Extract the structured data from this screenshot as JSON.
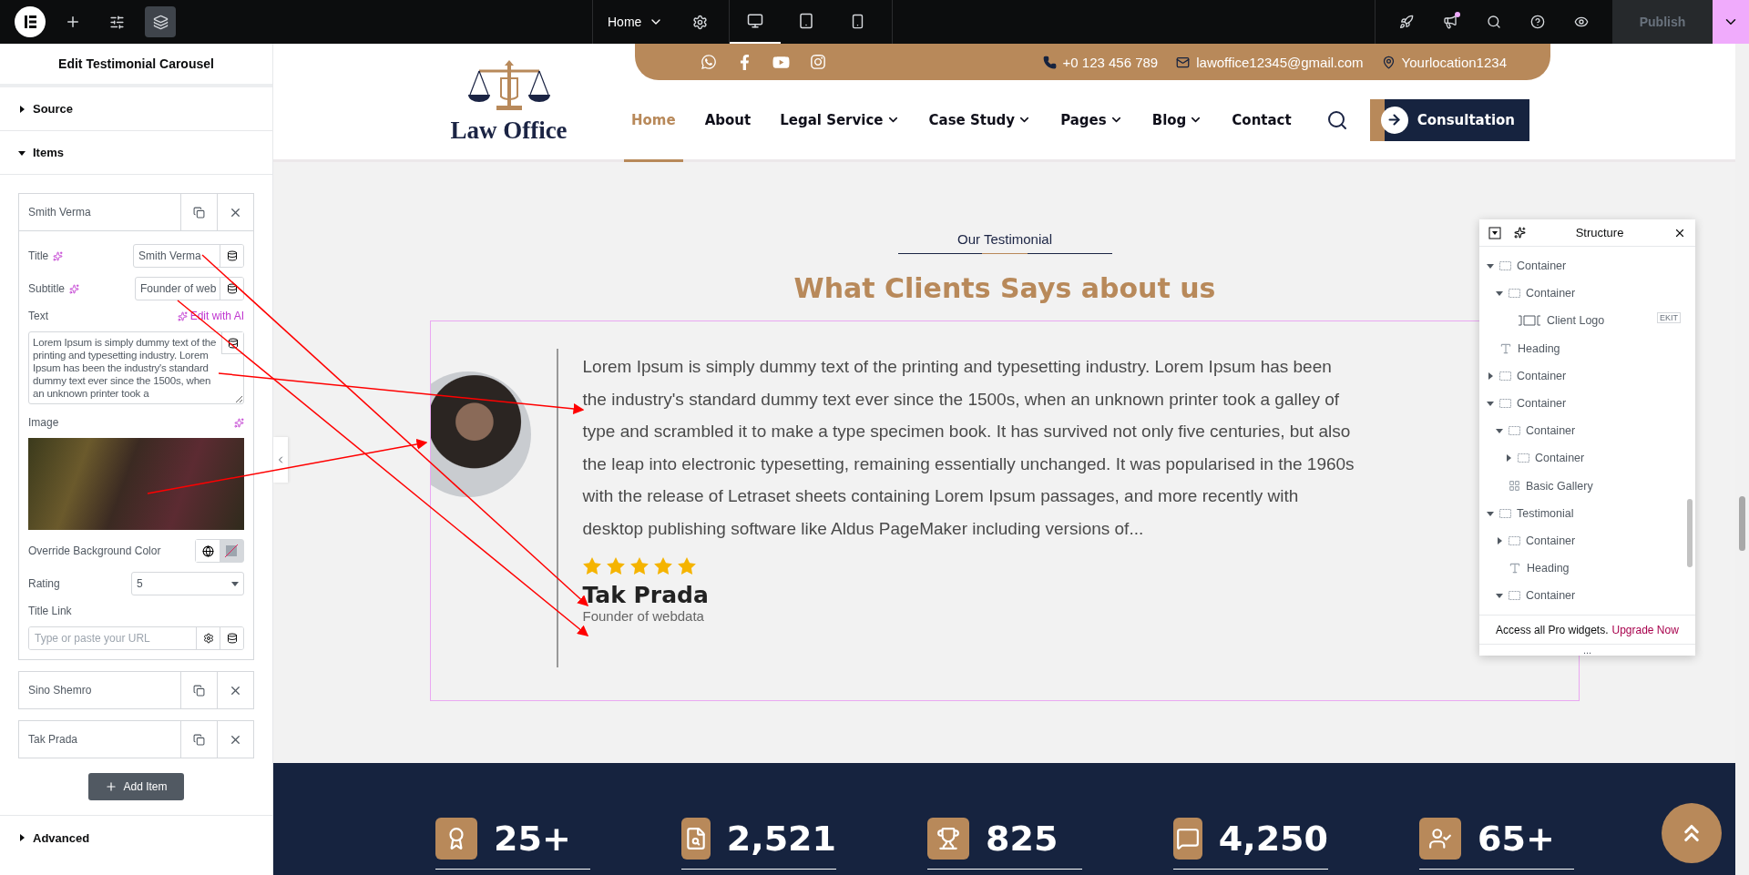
{
  "editor_bar": {
    "tools": [
      {
        "kind": "add",
        "selected": false
      },
      {
        "kind": "settings",
        "selected": false
      },
      {
        "kind": "structure",
        "selected": true
      }
    ],
    "page": "Home",
    "devices": [
      {
        "kind": "desktop",
        "selected": true
      },
      {
        "kind": "tablet",
        "selected": false
      },
      {
        "kind": "mobile",
        "selected": false
      }
    ],
    "actions": [
      {
        "kind": "launch",
        "notify": false
      },
      {
        "kind": "whatsnew",
        "notify": true
      },
      {
        "kind": "search",
        "notify": false
      },
      {
        "kind": "help",
        "notify": false
      },
      {
        "kind": "preview",
        "notify": false
      }
    ],
    "publish": "Publish"
  },
  "panel": {
    "title": "Edit Testimonial Carousel",
    "sections": [
      {
        "label": "Source",
        "expanded": false
      },
      {
        "label": "Items",
        "expanded": true
      }
    ],
    "items": [
      {
        "title": "Smith Verma",
        "expanded": true
      },
      {
        "title": "Sino Shemro",
        "expanded": false
      },
      {
        "title": "Tak Prada",
        "expanded": false
      }
    ],
    "form": {
      "title_label": "Title",
      "title_value": "Smith Verma",
      "subtitle_label": "Subtitle",
      "subtitle_value": "Founder of web",
      "text_label": "Text",
      "edit_ai": "Edit with AI",
      "text_value": "Lorem Ipsum is simply dummy text of the printing and typesetting industry. Lorem Ipsum has been the industry's standard dummy text ever since the 1500s, when an unknown printer took a",
      "image_label": "Image",
      "override_label": "Override Background Color",
      "rating_label": "Rating",
      "rating_value": "5",
      "link_label": "Title Link",
      "link_placeholder": "Type or paste your URL"
    },
    "add_item": "Add Item",
    "advanced": {
      "label": "Advanced",
      "expanded": false
    }
  },
  "site": {
    "contacts": {
      "phone": "+0 123 456 789",
      "email": "lawoffice12345@gmail.com",
      "location": "Yourlocation1234"
    },
    "logo": "Law Office",
    "nav": [
      {
        "label": "Home",
        "selected": true,
        "dropdown": false
      },
      {
        "label": "About",
        "selected": false,
        "dropdown": false
      },
      {
        "label": "Legal Service",
        "selected": false,
        "dropdown": true
      },
      {
        "label": "Case Study",
        "selected": false,
        "dropdown": true
      },
      {
        "label": "Pages",
        "selected": false,
        "dropdown": true
      },
      {
        "label": "Blog",
        "selected": false,
        "dropdown": true
      },
      {
        "label": "Contact",
        "selected": false,
        "dropdown": false
      }
    ],
    "cta": "Consultation",
    "testimonial": {
      "eyebrow": "Our Testimonial",
      "heading": "What Clients Says about us",
      "quote": "Lorem Ipsum is simply dummy text of the printing and typesetting industry. Lorem Ipsum has been the industry's standard dummy text ever since the 1500s, when an unknown printer took a galley of type and scrambled it to make a type specimen book. It has survived not only five centuries, but also the leap into electronic typesetting, remaining essentially unchanged. It was popularised in the 1960s with the release of Letraset sheets containing Lorem Ipsum passages, and more recently with desktop publishing software like Aldus PageMaker including versions of...",
      "stars": 5,
      "name": "Tak Prada",
      "role": "Founder of webdata"
    },
    "stats": [
      {
        "kind": "rating",
        "value": "25+"
      },
      {
        "kind": "cases",
        "value": "2,521"
      },
      {
        "kind": "awards",
        "value": "825"
      },
      {
        "kind": "reviews",
        "value": "4,250"
      },
      {
        "kind": "lawyers",
        "value": "65+"
      }
    ]
  },
  "structure": {
    "title": "Structure",
    "tree": [
      {
        "label": "Container",
        "kind": "container",
        "expanded": true,
        "children": [
          {
            "label": "Container",
            "kind": "container",
            "expanded": true,
            "children": [
              {
                "label": "Client Logo",
                "kind": "logo",
                "badge": "EKIT"
              }
            ]
          }
        ]
      },
      {
        "label": "Heading",
        "kind": "heading"
      },
      {
        "label": "Container",
        "kind": "container",
        "expanded": false
      },
      {
        "label": "Container",
        "kind": "container",
        "expanded": true,
        "children": [
          {
            "label": "Container",
            "kind": "container",
            "expanded": true,
            "children": [
              {
                "label": "Container",
                "kind": "container",
                "expanded": false
              }
            ]
          },
          {
            "label": "Basic Gallery",
            "kind": "gallery"
          }
        ]
      },
      {
        "label": "Testimonial",
        "kind": "container",
        "expanded": true,
        "children": [
          {
            "label": "Container",
            "kind": "container",
            "expanded": false
          },
          {
            "label": "Heading",
            "kind": "heading"
          },
          {
            "label": "Container",
            "kind": "container",
            "expanded": true
          }
        ]
      }
    ],
    "footer": {
      "text": "Access all Pro widgets.",
      "link": "Upgrade Now"
    },
    "handle": "..."
  }
}
